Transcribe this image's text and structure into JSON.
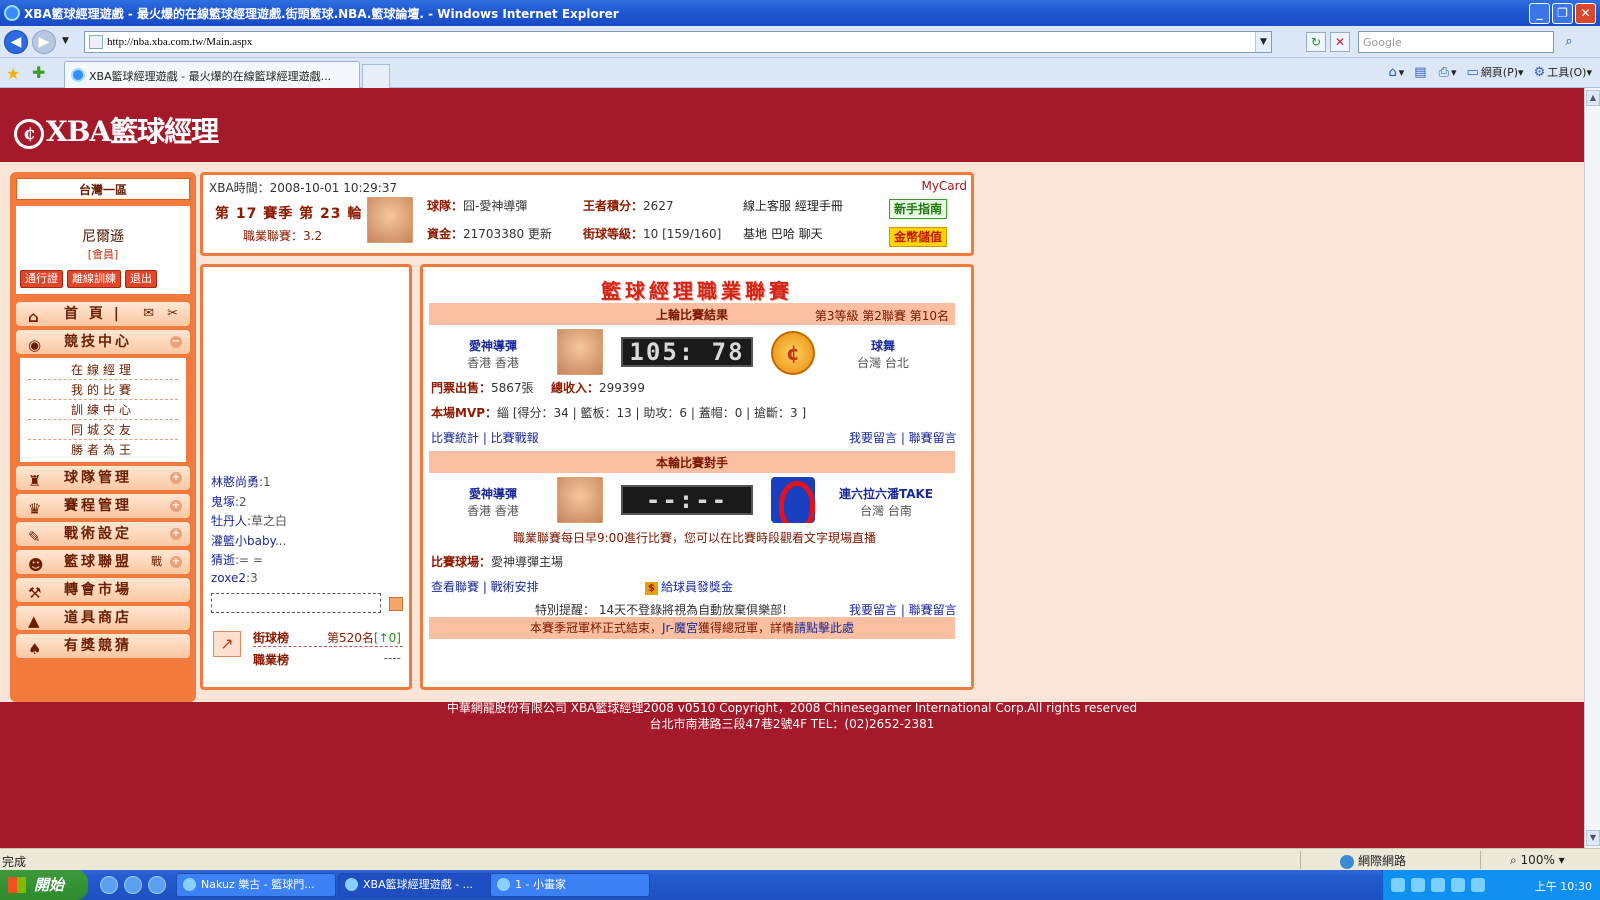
{
  "window": {
    "title": "XBA籃球經理遊戲 - 最火爆的在線籃球經理遊戲.街頭籃球.NBA.籃球論壇. - Windows Internet Explorer",
    "url": "http://nba.xba.com.tw/Main.aspx",
    "search_placeholder": "Google",
    "tab_title": "XBA籃球經理遊戲 - 最火爆的在線籃球經理遊戲...",
    "cmd_page": "網頁(P)",
    "cmd_tools": "工具(O)",
    "status_text": "完成",
    "zone": "網際網路",
    "zoom": "100%"
  },
  "site": {
    "logo": "XBA籃球經理",
    "server": "台灣一區",
    "user_name": "尼爾遜",
    "user_role": "[會員]",
    "user_buttons": [
      "通行證",
      "離線訓練",
      "退出"
    ]
  },
  "menu": {
    "home": "首 頁 |",
    "items": [
      {
        "label": "競技中心",
        "icon": "basketball-icon"
      },
      {
        "label": "球隊管理",
        "icon": "trophy-icon"
      },
      {
        "label": "賽程管理",
        "icon": "cup-icon"
      },
      {
        "label": "戰術設定",
        "icon": "tactics-icon"
      },
      {
        "label": "籃球聯盟",
        "icon": "league-icon"
      },
      {
        "label": "轉會市場",
        "icon": "hammer-icon"
      },
      {
        "label": "道具商店",
        "icon": "shop-icon"
      },
      {
        "label": "有獎競猜",
        "icon": "spade-icon"
      }
    ],
    "league_extra": "戰",
    "submenu": [
      "在線經理",
      "我的比賽",
      "訓練中心",
      "同城交友",
      "勝者為王"
    ]
  },
  "info": {
    "xba_time": "XBA時間：2008-10-01 10:29:37",
    "mycard": "MyCard",
    "season": "第 17 賽季  第 23 輪",
    "pro_league": "職業聯賽：3.2",
    "team_label": "球隊：",
    "team_value": "囧-愛神導彈",
    "king_label": "王者積分：",
    "king_value": "2627",
    "funds_label": "資金：",
    "funds_value": "21703380 更新",
    "street_label": "街球等級：",
    "street_value": "10 [159/160]",
    "links_row1": "線上客服  經理手冊",
    "links_row2": "基地  巴哈  聊天",
    "newbie_btn": "新手指南",
    "gold_btn": "金幣儲值"
  },
  "chat": {
    "messages": [
      {
        "user": "林憨尚勇",
        "text": ":1"
      },
      {
        "user": "鬼塚",
        "text": ":2"
      },
      {
        "user": "牡丹人",
        "text": ":草之白"
      },
      {
        "user": "灌籃小baby",
        "text": "..."
      },
      {
        "user": "猜逝",
        "text": ":= ="
      },
      {
        "user": "zoxe2",
        "text": ":3"
      }
    ],
    "rank1_label": "街球榜",
    "rank1_value": "第520名",
    "rank1_change": "[↑0]",
    "rank2_label": "職業榜",
    "rank2_value": "----"
  },
  "league": {
    "title": "籃球經理職業聯賽",
    "last_round_title": "上輪比賽結果",
    "last_round_info": "第3等級  第2聯賽  第10名",
    "home_team": "愛神導彈",
    "home_loc": "香港  香港",
    "score": "105: 78",
    "away_team": "球舞",
    "away_loc": "台灣  台北",
    "tickets_label": "門票出售：",
    "tickets_value": "5867張",
    "income_label": "總收入：",
    "income_value": "299399",
    "mvp_label": "本場MVP：",
    "mvp_value": "緇 [得分：34 | 籃板：13 | 助攻：6 | 蓋帽：0 | 搶斷：3 ]",
    "stats_links": "比賽統計 | 比賽戰報",
    "msg_links": "我要留言 | 聯賽留言",
    "this_round_title": "本輪比賽對手",
    "next_home_team": "愛神導彈",
    "next_home_loc": "香港  香港",
    "next_score": "--:--",
    "next_away_team": "連六拉六潘TAKE",
    "next_away_loc": "台灣  台南",
    "schedule_note": "職業聯賽每日早9:00進行比賽，您可以在比賽時段觀看文字現場直播",
    "venue_label": "比賽球場：",
    "venue_value": "愛神導彈主場",
    "view_links": "查看聯賽 | 戰術安排",
    "bonus_link": "給球員發獎金",
    "reminder": "特別提醒：  14天不登錄將視為自動放棄俱樂部!",
    "msg_links2": "我要留言 | 聯賽留言",
    "notice_pre": "本賽季冠軍杯正式結束，",
    "notice_link": "Jr-魔宮",
    "notice_mid": "獲得總冠軍，詳情",
    "notice_end": "請點擊此處"
  },
  "footer": {
    "line1": "中華網龍股份有限公司  XBA籃球經理2008 v0510    Copyright，2008 Chinesegamer International Corp.All rights reserved",
    "line2": "台北市南港路三段47巷2號4F TEL：(02)2652-2381"
  },
  "taskbar": {
    "start": "開始",
    "tasks": [
      "Nakuz 樂古 - 籃球門...",
      "XBA籃球經理遊戲 - ...",
      "1 - 小畫家"
    ],
    "clock": "上午 10:30"
  }
}
